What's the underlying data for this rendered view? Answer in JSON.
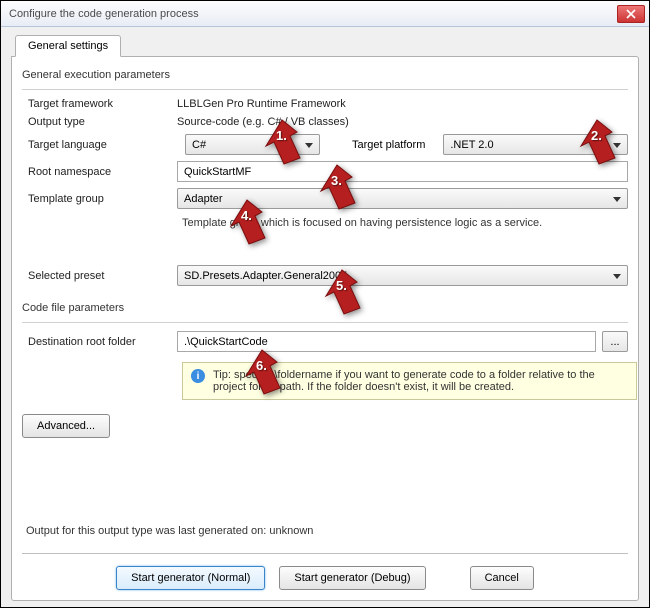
{
  "window": {
    "title": "Configure the code generation process"
  },
  "tab": {
    "label": "General settings"
  },
  "groups": {
    "execution": "General execution parameters",
    "codefile": "Code file parameters"
  },
  "labels": {
    "target_framework": "Target framework",
    "output_type": "Output type",
    "target_language": "Target language",
    "target_platform": "Target platform",
    "root_namespace": "Root namespace",
    "template_group": "Template group",
    "selected_preset": "Selected preset",
    "dest_folder": "Destination root folder"
  },
  "values": {
    "target_framework": "LLBLGen Pro Runtime Framework",
    "output_type": "Source-code (e.g. C# / VB classes)",
    "target_language": "C#",
    "target_platform": ".NET 2.0",
    "root_namespace": "QuickStartMF",
    "template_group": "Adapter",
    "template_group_hint": "Template group which is focused on having persistence logic as a service.",
    "selected_preset": "SD.Presets.Adapter.General2005",
    "dest_folder": ".\\QuickStartCode",
    "tip": "Tip: specify .\\foldername if you want to generate code to a folder relative to the project folder path. If the folder doesn't exist, it will be created."
  },
  "buttons": {
    "browse": "...",
    "advanced": "Advanced...",
    "start_normal": "Start generator (Normal)",
    "start_debug": "Start generator (Debug)",
    "cancel": "Cancel"
  },
  "status": {
    "output_line": "Output for this output type was last generated on: unknown"
  },
  "annotations": {
    "a1": "1.",
    "a2": "2.",
    "a3": "3.",
    "a4": "4.",
    "a5": "5.",
    "a6": "6."
  }
}
